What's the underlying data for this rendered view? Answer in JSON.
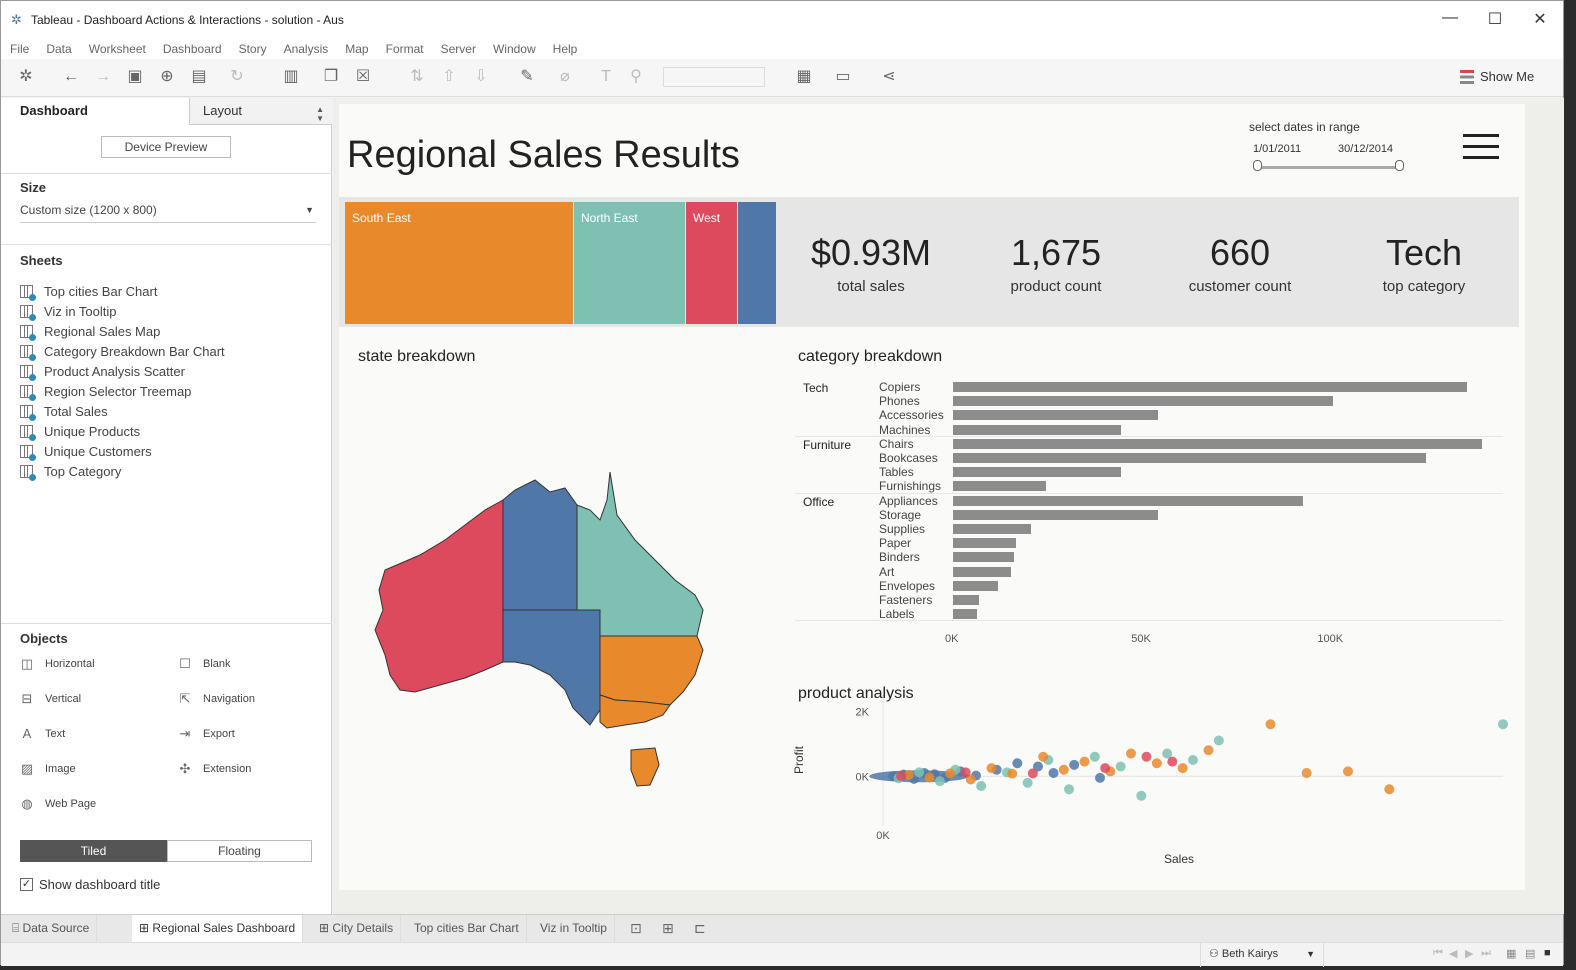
{
  "window": {
    "title": "Tableau - Dashboard Actions & Interactions - solution - Aus"
  },
  "menu": [
    "File",
    "Data",
    "Worksheet",
    "Dashboard",
    "Story",
    "Analysis",
    "Map",
    "Format",
    "Server",
    "Window",
    "Help"
  ],
  "toolbar": {
    "show_me_label": "Show Me"
  },
  "left_pane": {
    "tab_dashboard": "Dashboard",
    "tab_layout": "Layout",
    "device_preview_label": "Device Preview",
    "size_title": "Size",
    "size_value": "Custom size (1200 x 800)",
    "sheets_title": "Sheets",
    "sheets": [
      "Top cities Bar Chart",
      "Viz in Tooltip",
      "Regional Sales Map",
      "Category Breakdown Bar Chart",
      "Product Analysis Scatter",
      "Region Selector Treemap",
      "Total Sales",
      "Unique Products",
      "Unique Customers",
      "Top Category"
    ],
    "objects_title": "Objects",
    "objects": [
      "Horizontal",
      "Blank",
      "Vertical",
      "Navigation",
      "Text",
      "Export",
      "Image",
      "Extension",
      "Web Page"
    ],
    "tiled_label": "Tiled",
    "floating_label": "Floating",
    "show_title_label": "Show dashboard title"
  },
  "dashboard": {
    "title": "Regional Sales Results",
    "date_filter": {
      "label": "select dates in range",
      "start": "1/01/2011",
      "end": "30/12/2014"
    },
    "treemap": [
      {
        "label": "South East",
        "share": 0.53,
        "color": "#e88a2c"
      },
      {
        "label": "North East",
        "share": 0.26,
        "color": "#7ec1b3"
      },
      {
        "label": "West",
        "share": 0.12,
        "color": "#dd4a5e"
      },
      {
        "label": "",
        "share": 0.09,
        "color": "#4f78a8"
      }
    ],
    "kpis": [
      {
        "value": "$0.93M",
        "label": "total sales"
      },
      {
        "value": "1,675",
        "label": "product count"
      },
      {
        "value": "660",
        "label": "customer count"
      },
      {
        "value": "Tech",
        "label": "top category"
      }
    ],
    "state_title": "state breakdown",
    "category_title": "category breakdown",
    "product_title": "product analysis",
    "colors": {
      "south_east": "#e88a2c",
      "north_east": "#7ec1b3",
      "west": "#dd4a5e",
      "central": "#4f78a8",
      "bar": "#8c8c8c"
    }
  },
  "chart_data": [
    {
      "type": "bar",
      "title": "category breakdown",
      "groups": [
        {
          "name": "Tech",
          "items": [
            {
              "name": "Copiers",
              "value": 138000
            },
            {
              "name": "Phones",
              "value": 102000
            },
            {
              "name": "Accessories",
              "value": 55000
            },
            {
              "name": "Machines",
              "value": 45000
            }
          ]
        },
        {
          "name": "Furniture",
          "items": [
            {
              "name": "Chairs",
              "value": 142000
            },
            {
              "name": "Bookcases",
              "value": 127000
            },
            {
              "name": "Tables",
              "value": 45000
            },
            {
              "name": "Furnishings",
              "value": 25000
            }
          ]
        },
        {
          "name": "Office",
          "items": [
            {
              "name": "Appliances",
              "value": 94000
            },
            {
              "name": "Storage",
              "value": 55000
            },
            {
              "name": "Supplies",
              "value": 21000
            },
            {
              "name": "Paper",
              "value": 17000
            },
            {
              "name": "Binders",
              "value": 16500
            },
            {
              "name": "Art",
              "value": 15500
            },
            {
              "name": "Envelopes",
              "value": 12000
            },
            {
              "name": "Fasteners",
              "value": 7000
            },
            {
              "name": "Labels",
              "value": 6500
            }
          ]
        }
      ],
      "xticks": [
        "0K",
        "50K",
        "100K"
      ],
      "xlim": [
        0,
        145000
      ]
    },
    {
      "type": "scatter",
      "title": "product analysis",
      "xlabel": "Sales",
      "ylabel": "Profit",
      "xticks": [
        "0K"
      ],
      "yticks": [
        "2K",
        "0K"
      ],
      "xlim": [
        0,
        12000
      ],
      "ylim": [
        -1500,
        2500
      ],
      "points": [
        [
          200,
          0,
          "central"
        ],
        [
          400,
          50,
          "central"
        ],
        [
          600,
          -80,
          "central"
        ],
        [
          800,
          100,
          "central"
        ],
        [
          1000,
          60,
          "central"
        ],
        [
          1200,
          -50,
          "central"
        ],
        [
          1500,
          150,
          "central"
        ],
        [
          1800,
          20,
          "central"
        ],
        [
          2200,
          200,
          "central"
        ],
        [
          2600,
          400,
          "central"
        ],
        [
          3000,
          300,
          "central"
        ],
        [
          3300,
          100,
          "central"
        ],
        [
          3700,
          350,
          "central"
        ],
        [
          4200,
          -50,
          "central"
        ],
        [
          300,
          -60,
          "north_east"
        ],
        [
          700,
          120,
          "north_east"
        ],
        [
          1100,
          -150,
          "north_east"
        ],
        [
          1400,
          200,
          "north_east"
        ],
        [
          1900,
          -300,
          "north_east"
        ],
        [
          2400,
          120,
          "north_east"
        ],
        [
          2800,
          -200,
          "north_east"
        ],
        [
          3200,
          500,
          "north_east"
        ],
        [
          3600,
          -400,
          "north_east"
        ],
        [
          4100,
          600,
          "north_east"
        ],
        [
          4600,
          300,
          "north_east"
        ],
        [
          5000,
          -600,
          "north_east"
        ],
        [
          5500,
          700,
          "north_east"
        ],
        [
          6000,
          500,
          "north_east"
        ],
        [
          6500,
          1100,
          "north_east"
        ],
        [
          12000,
          1600,
          "north_east"
        ],
        [
          500,
          40,
          "south_east"
        ],
        [
          900,
          -40,
          "south_east"
        ],
        [
          1300,
          90,
          "south_east"
        ],
        [
          1700,
          -100,
          "south_east"
        ],
        [
          2100,
          250,
          "south_east"
        ],
        [
          2500,
          80,
          "south_east"
        ],
        [
          3100,
          600,
          "south_east"
        ],
        [
          3500,
          200,
          "south_east"
        ],
        [
          3900,
          450,
          "south_east"
        ],
        [
          4400,
          150,
          "south_east"
        ],
        [
          4800,
          700,
          "south_east"
        ],
        [
          5300,
          400,
          "south_east"
        ],
        [
          5800,
          250,
          "south_east"
        ],
        [
          6300,
          800,
          "south_east"
        ],
        [
          7500,
          1600,
          "south_east"
        ],
        [
          8200,
          100,
          "south_east"
        ],
        [
          9000,
          150,
          "south_east"
        ],
        [
          9800,
          -400,
          "south_east"
        ],
        [
          350,
          10,
          "west"
        ],
        [
          1600,
          120,
          "west"
        ],
        [
          2900,
          90,
          "west"
        ],
        [
          4300,
          250,
          "west"
        ],
        [
          5100,
          600,
          "west"
        ],
        [
          5600,
          450,
          "west"
        ]
      ]
    }
  ],
  "bottom_tabs": [
    "Data Source",
    "Regional Sales Dashboard",
    "City Details",
    "Top cities Bar Chart",
    "Viz in Tooltip"
  ],
  "status": {
    "user": "Beth Kairys"
  }
}
